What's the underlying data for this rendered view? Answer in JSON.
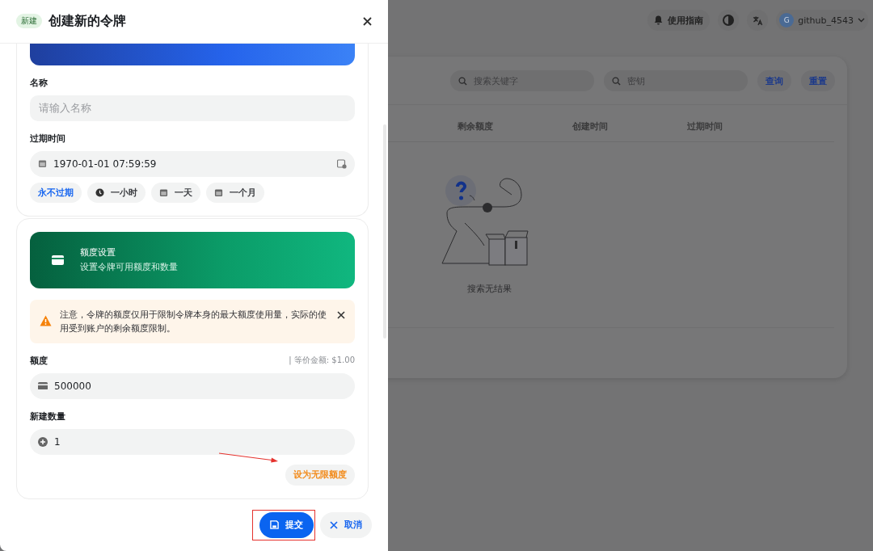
{
  "background_page": {
    "header": {
      "guide": "使用指南",
      "avatar_letter": "G",
      "user": "github_4543"
    },
    "search": {
      "keyword_placeholder": "搜索关键字",
      "key_placeholder": "密钥",
      "query": "查询",
      "reset": "重置"
    },
    "table": {
      "columns": [
        "剩余额度",
        "创建时间",
        "过期时间"
      ],
      "empty_text": "搜索无结果"
    }
  },
  "drawer": {
    "badge": "新建",
    "title": "创建新的令牌",
    "basic": {
      "name_label": "名称",
      "name_placeholder": "请输入名称",
      "expiry_label": "过期时间",
      "expiry_value": "1970-01-01 07:59:59",
      "quick_options": [
        {
          "label": "永不过期",
          "kind": "plain",
          "selected": true
        },
        {
          "label": "一小时",
          "kind": "clock",
          "selected": false
        },
        {
          "label": "一天",
          "kind": "calendar",
          "selected": false
        },
        {
          "label": "一个月",
          "kind": "calendar",
          "selected": false
        }
      ]
    },
    "quota": {
      "banner_title": "额度设置",
      "banner_subtitle": "设置令牌可用额度和数量",
      "notice": "注意，令牌的额度仅用于限制令牌本身的最大额度使用量，实际的使用受到账户的剩余额度限制。",
      "quota_label": "额度",
      "quota_hint": "| 等价金额: $1.00",
      "quota_value": "500000",
      "count_label": "新建数量",
      "count_value": "1",
      "unlimited_button": "设为无限额度"
    },
    "footer": {
      "submit": "提交",
      "cancel": "取消"
    }
  }
}
